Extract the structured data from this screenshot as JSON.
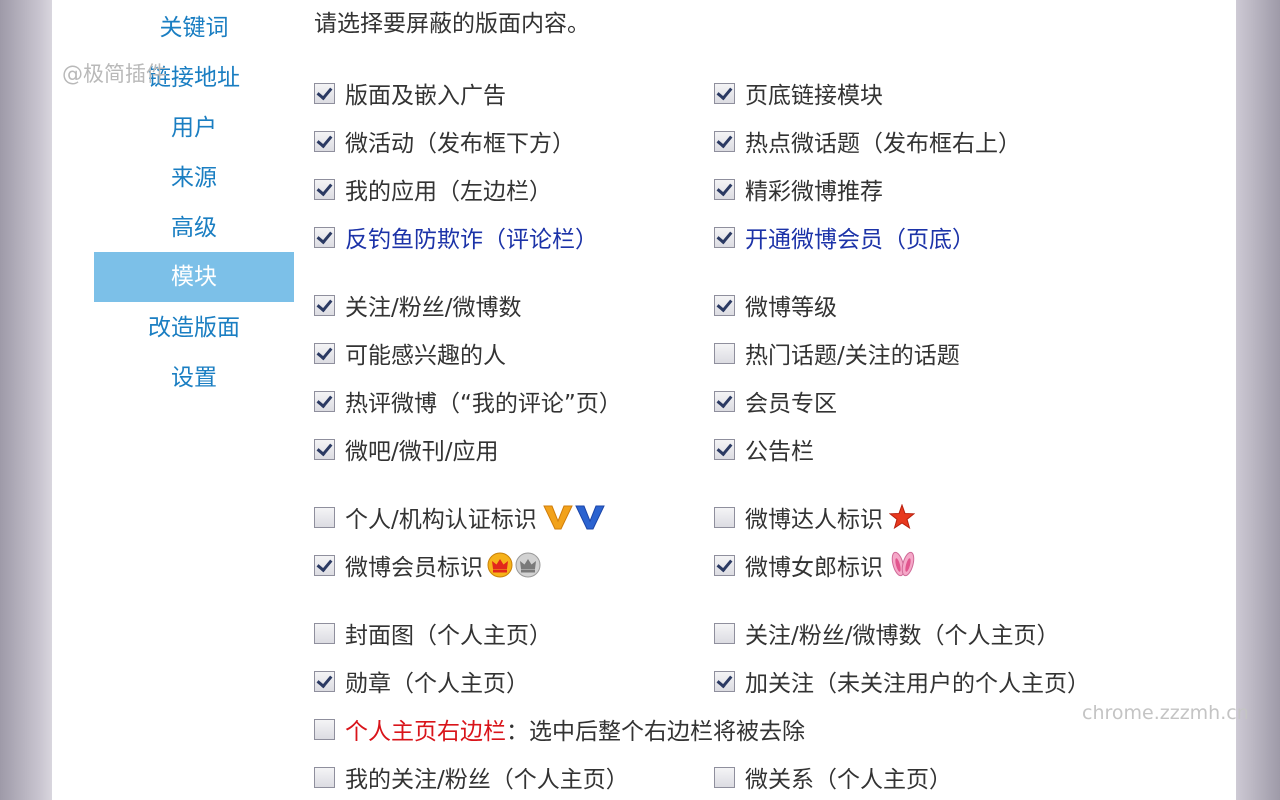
{
  "watermarks": {
    "top_left": "@极简插件",
    "bottom_right": "chrome.zzzmh.cn"
  },
  "sidebar": {
    "items": [
      {
        "label": "关键词",
        "active": false
      },
      {
        "label": "链接地址",
        "active": false
      },
      {
        "label": "用户",
        "active": false
      },
      {
        "label": "来源",
        "active": false
      },
      {
        "label": "高级",
        "active": false
      },
      {
        "label": "模块",
        "active": true
      },
      {
        "label": "改造版面",
        "active": false
      },
      {
        "label": "设置",
        "active": false
      }
    ]
  },
  "main": {
    "prompt": "请选择要屏蔽的版面内容。",
    "options": [
      {
        "label": "版面及嵌入广告",
        "checked": true
      },
      {
        "label": "页底链接模块",
        "checked": true
      },
      {
        "label": "微活动（发布框下方）",
        "checked": true
      },
      {
        "label": "热点微话题（发布框右上）",
        "checked": true
      },
      {
        "label": "我的应用（左边栏）",
        "checked": true
      },
      {
        "label": "精彩微博推荐",
        "checked": true
      },
      {
        "label": "反钓鱼防欺诈（评论栏）",
        "checked": true,
        "color": "#1c33a8"
      },
      {
        "label": "开通微博会员（页底）",
        "checked": true,
        "color": "#1c33a8"
      },
      {
        "label": "关注/粉丝/微博数",
        "checked": true
      },
      {
        "label": "微博等级",
        "checked": true
      },
      {
        "label": "可能感兴趣的人",
        "checked": true
      },
      {
        "label": "热门话题/关注的话题",
        "checked": false
      },
      {
        "label": "热评微博（“我的评论”页）",
        "checked": true
      },
      {
        "label": "会员专区",
        "checked": true
      },
      {
        "label": "微吧/微刊/应用",
        "checked": true
      },
      {
        "label": "公告栏",
        "checked": true
      },
      {
        "label": "个人/机构认证标识",
        "checked": false,
        "icons": [
          "verified-v-orange-icon",
          "verified-v-blue-icon"
        ]
      },
      {
        "label": "微博达人标识",
        "checked": false,
        "icons": [
          "daren-star-icon"
        ]
      },
      {
        "label": "微博会员标识",
        "checked": true,
        "icons": [
          "vip-crown-color-icon",
          "vip-crown-gray-icon"
        ]
      },
      {
        "label": "微博女郎标识",
        "checked": true,
        "icons": [
          "bunny-ears-icon"
        ]
      },
      {
        "label": "封面图（个人主页）",
        "checked": false
      },
      {
        "label": "关注/粉丝/微博数（个人主页）",
        "checked": false
      },
      {
        "label": "勋章（个人主页）",
        "checked": true
      },
      {
        "label": "加关注（未关注用户的个人主页）",
        "checked": true
      },
      {
        "label": "个人主页右边栏",
        "suffix": "：选中后整个右边栏将被去除",
        "checked": false,
        "color": "#d9141a"
      },
      {
        "label": "我的关注/粉丝（个人主页）",
        "checked": false
      },
      {
        "label": "微关系（个人主页）",
        "checked": false
      }
    ]
  }
}
